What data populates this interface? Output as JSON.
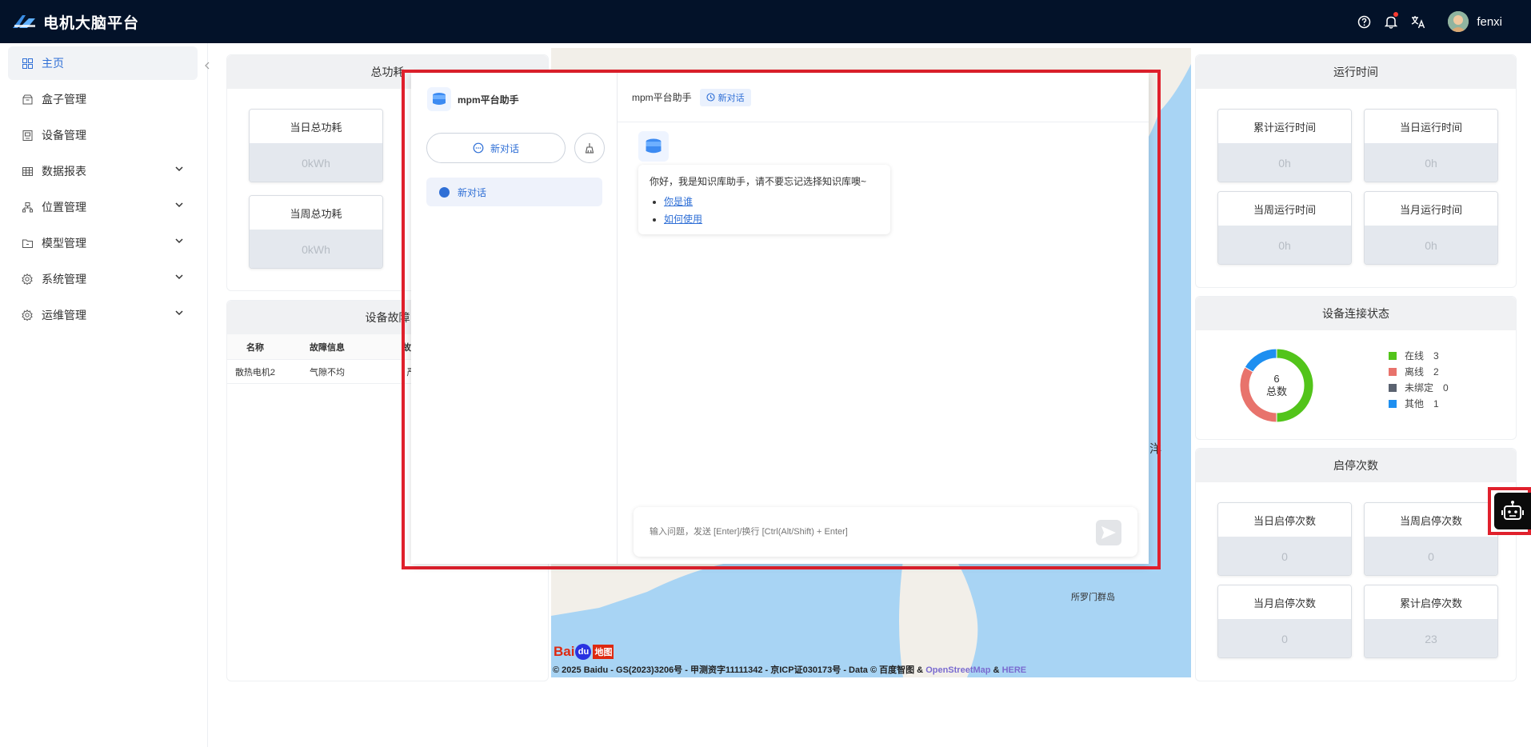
{
  "header": {
    "app_title": "电机大脑平台",
    "username": "fenxi",
    "icons": [
      "help-icon",
      "bell-icon",
      "translate-icon"
    ]
  },
  "sidebar": {
    "items": [
      {
        "label": "主页",
        "icon": "grid-icon",
        "active": true
      },
      {
        "label": "盒子管理",
        "icon": "box-icon"
      },
      {
        "label": "设备管理",
        "icon": "device-icon"
      },
      {
        "label": "数据报表",
        "icon": "table-icon",
        "expandable": true
      },
      {
        "label": "位置管理",
        "icon": "location-icon",
        "expandable": true
      },
      {
        "label": "模型管理",
        "icon": "folder-icon",
        "expandable": true
      },
      {
        "label": "系统管理",
        "icon": "gear-icon",
        "expandable": true
      },
      {
        "label": "运维管理",
        "icon": "gear-icon",
        "expandable": true
      }
    ]
  },
  "power_panel": {
    "title": "总功耗",
    "stats": [
      {
        "label": "当日总功耗",
        "value": "0kWh"
      },
      {
        "label": "当周总功耗",
        "value": "0kWh"
      }
    ]
  },
  "fault_panel": {
    "title": "设备故障",
    "columns": [
      "名称",
      "故障信息",
      "故障"
    ],
    "rows": [
      [
        "散热电机2",
        "气隙不均",
        "严"
      ]
    ]
  },
  "map": {
    "labels": {
      "sea": "洋",
      "islands": "所罗门群岛"
    },
    "logo_text": "Bai",
    "logo_du": "du",
    "logo_map": "地图",
    "copyright": "© 2025 Baidu - GS(2023)3206号 - 甲测资字11111342 - 京ICP证030173号 - Data © 百度智图 &",
    "osm": "OpenStreetMap",
    "amp": "&",
    "here": "HERE"
  },
  "chat": {
    "side_title": "mpm平台助手",
    "new_chat_label": "新对话",
    "conversation": "新对话",
    "header_title": "mpm平台助手",
    "header_tag": "新对话",
    "greeting": "你好，我是知识库助手，请不要忘记选择知识库噢~",
    "suggestions": [
      "你是谁",
      "如何使用"
    ],
    "input_placeholder": "输入问题，发送 [Enter]/换行 [Ctrl(Alt/Shift) + Enter]"
  },
  "runtime_panel": {
    "title": "运行时间",
    "stats": [
      {
        "label": "累计运行时间",
        "value": "0h"
      },
      {
        "label": "当日运行时间",
        "value": "0h"
      },
      {
        "label": "当周运行时间",
        "value": "0h"
      },
      {
        "label": "当月运行时间",
        "value": "0h"
      }
    ]
  },
  "connection_panel": {
    "title": "设备连接状态",
    "total_value": "6",
    "total_label": "总数",
    "legend": [
      {
        "label": "在线",
        "count": "3",
        "color": "#52c41a"
      },
      {
        "label": "离线",
        "count": "2",
        "color": "#e8736c"
      },
      {
        "label": "未绑定",
        "count": "0",
        "color": "#5a6270"
      },
      {
        "label": "其他",
        "count": "1",
        "color": "#1e8ff0"
      }
    ]
  },
  "startstop_panel": {
    "title": "启停次数",
    "stats": [
      {
        "label": "当日启停次数",
        "value": "0"
      },
      {
        "label": "当周启停次数",
        "value": "0"
      },
      {
        "label": "当月启停次数",
        "value": "0"
      },
      {
        "label": "累计启停次数",
        "value": "23"
      }
    ]
  }
}
